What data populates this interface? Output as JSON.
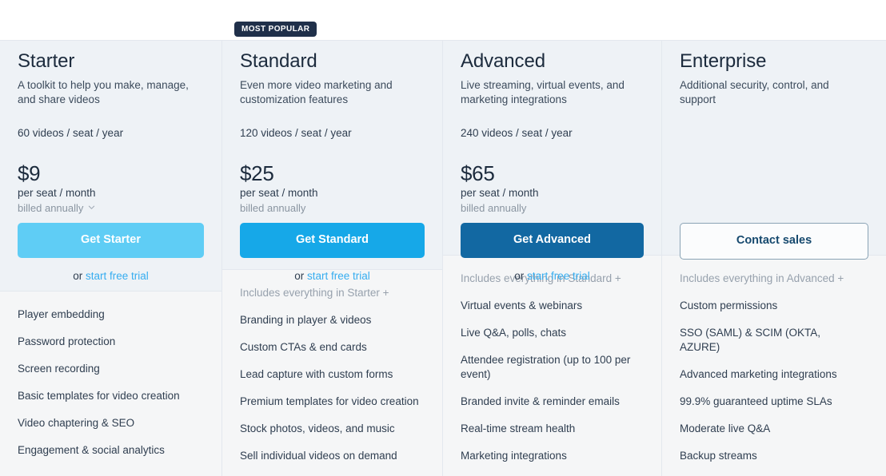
{
  "badge": {
    "label": "MOST POPULAR",
    "attached_to_plan": "Standard",
    "color": "#20304a"
  },
  "colors": {
    "card_background": "#eef2f6",
    "features_background": "#f5f6f7",
    "divider": "#e3e8ee",
    "heading_text": "#1c2b3d",
    "body_text": "#2f3e50",
    "muted_text": "#97a1ad",
    "link": "#36adf0",
    "cta_starter": "#5fcdf5",
    "cta_standard": "#16a8e8",
    "cta_advanced": "#1268a2",
    "cta_outline_border": "#8aa3b5",
    "cta_outline_text": "#16496e"
  },
  "plans": [
    {
      "name": "Starter",
      "description": "A toolkit to help you make, manage, and share videos",
      "quota": "60 videos / seat / year",
      "price": "$9",
      "price_unit": "per seat / month",
      "billing_note": "billed annually",
      "has_billing_chevron": true,
      "cta_label": "Get Starter",
      "trial_prefix": "or ",
      "trial_link": "start free trial",
      "has_trial": true,
      "includes_note": "",
      "features": [
        "Player embedding",
        "Password protection",
        "Screen recording",
        "Basic templates for video creation",
        "Video chaptering & SEO",
        "Engagement & social analytics"
      ]
    },
    {
      "name": "Standard",
      "description": "Even more video marketing and customization features",
      "quota": "120 videos / seat / year",
      "price": "$25",
      "price_unit": "per seat / month",
      "billing_note": "billed annually",
      "has_billing_chevron": false,
      "cta_label": "Get Standard",
      "trial_prefix": "or ",
      "trial_link": "start free trial",
      "has_trial": true,
      "includes_note": "Includes everything in Starter +",
      "features": [
        "Branding in player & videos",
        "Custom CTAs & end cards",
        "Lead capture with custom forms",
        "Premium templates for video creation",
        "Stock photos, videos, and music",
        "Sell individual videos on demand"
      ]
    },
    {
      "name": "Advanced",
      "description": "Live streaming, virtual events, and marketing integrations",
      "quota": "240 videos / seat / year",
      "price": "$65",
      "price_unit": "per seat / month",
      "billing_note": "billed annually",
      "has_billing_chevron": false,
      "cta_label": "Get Advanced",
      "trial_prefix": "or ",
      "trial_link": "start free trial",
      "has_trial": true,
      "includes_note": "Includes everything in Standard +",
      "features": [
        "Virtual events & webinars",
        "Live Q&A, polls, chats",
        "Attendee registration (up to 100 per event)",
        "Branded invite & reminder emails",
        "Real-time stream health",
        "Marketing integrations"
      ]
    },
    {
      "name": "Enterprise",
      "description": "Additional security, control, and support",
      "quota": "",
      "price": "",
      "price_unit": "",
      "billing_note": "",
      "has_billing_chevron": false,
      "cta_label": "Contact sales",
      "trial_prefix": "",
      "trial_link": "",
      "has_trial": false,
      "includes_note": "Includes everything in Advanced +",
      "features": [
        "Custom permissions",
        "SSO (SAML) & SCIM (OKTA, AZURE)",
        "Advanced marketing integrations",
        "99.9% guaranteed uptime SLAs",
        "Moderate live Q&A",
        "Backup streams"
      ]
    }
  ]
}
